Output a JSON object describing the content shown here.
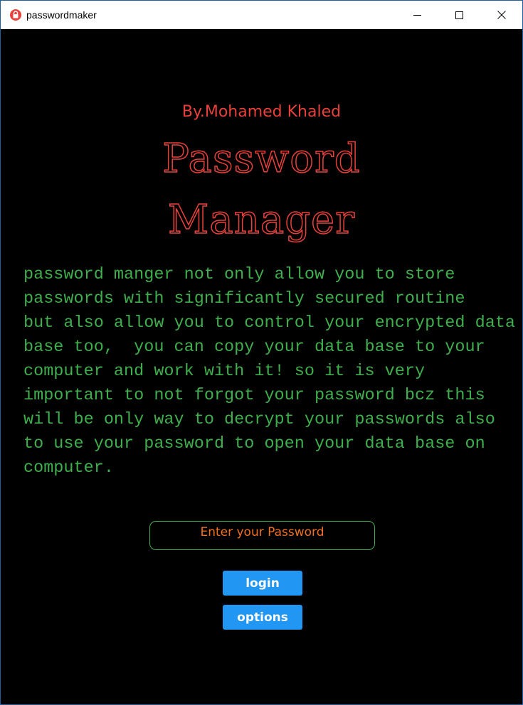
{
  "window": {
    "title": "passwordmaker",
    "icon": "lock-icon",
    "controls": [
      "minimize-icon",
      "maximize-icon",
      "close-icon"
    ]
  },
  "header": {
    "author": "By.Mohamed Khaled",
    "title_line1": "Password",
    "title_line2": "Manager"
  },
  "description": {
    "lines": [
      "password manger not only allow you to store",
      "passwords with significantly secured routine",
      "but also allow you to control your encrypted data",
      "base too,  you can copy your data base to your",
      "computer and work with it! so it is very",
      "important to not forgot your password bcz this",
      "will be only way to decrypt your passwords also",
      "to use your password to open your data base on",
      "computer."
    ]
  },
  "form": {
    "password_placeholder": "Enter your Password",
    "password_value": "",
    "login_label": "login",
    "options_label": "options"
  },
  "colors": {
    "background": "#000000",
    "accent_red": "#e8413c",
    "text_green": "#3fae4d",
    "placeholder_orange": "#f07020",
    "button_blue": "#2196f3"
  }
}
